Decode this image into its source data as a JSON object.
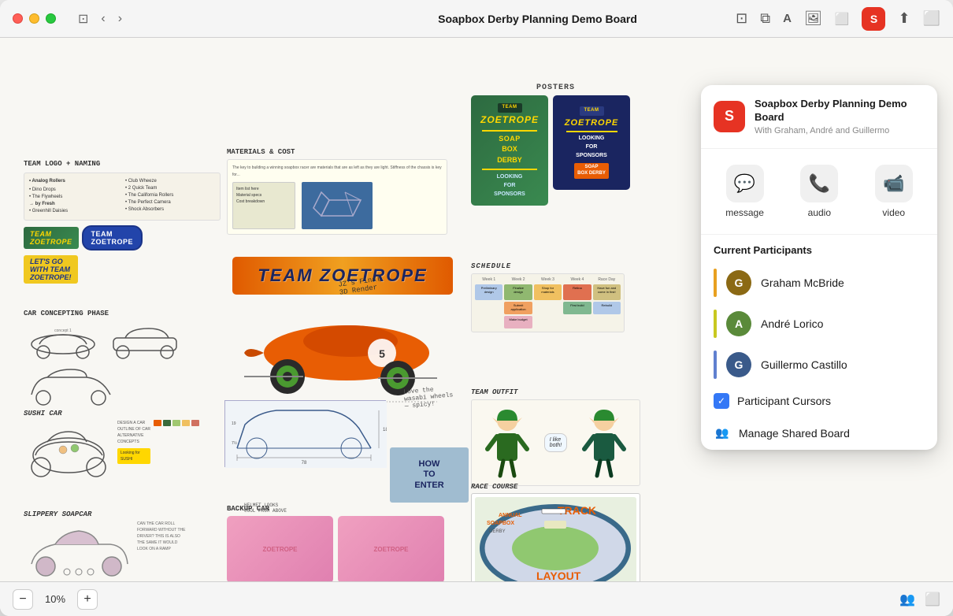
{
  "window": {
    "title": "Soapbox Derby Planning Demo Board"
  },
  "titlebar": {
    "title": "Soapbox Derby Planning Demo Board",
    "back_btn": "‹",
    "forward_btn": "›"
  },
  "toolbar": {
    "panel_icon": "⊡",
    "layers_icon": "⧉",
    "text_icon": "T",
    "image_icon": "🖼",
    "folder_icon": "⬜"
  },
  "bottom_bar": {
    "zoom_minus": "−",
    "zoom_value": "10%",
    "zoom_plus": "+",
    "share_icon": "👥",
    "grid_icon": "⊞"
  },
  "share_panel": {
    "app_icon_label": "S",
    "board_title": "Soapbox Derby Planning Demo Board",
    "board_subtitle": "With Graham, André and Guillermo",
    "actions": [
      {
        "key": "message",
        "label": "message",
        "icon": "💬"
      },
      {
        "key": "audio",
        "label": "audio",
        "icon": "📞"
      },
      {
        "key": "video",
        "label": "video",
        "icon": "📹"
      }
    ],
    "section_title": "Current Participants",
    "participants": [
      {
        "name": "Graham McBride",
        "color": "#e8a020",
        "initials": "G"
      },
      {
        "name": "André Lorico",
        "color": "#c8c820",
        "initials": "A"
      },
      {
        "name": "Guillermo Castillo",
        "color": "#6080d0",
        "initials": "G"
      }
    ],
    "participant_cursors_label": "Participant Cursors",
    "manage_label": "Manage Shared Board"
  },
  "board": {
    "posters_label": "POSTERS",
    "materials_label": "MATERIALS & COST",
    "team_logo_label": "TEAM LOGO + NAMING",
    "car_concepting_label": "CAR CONCEPTING PHASE",
    "sushi_car_label": "SUSHI CAR",
    "slippery_label": "SLIPPERY SOAPCAR",
    "backup_car_label": "BACKUP CAR",
    "schedule_label": "SCHEDULE",
    "team_outfit_label": "TEAM OUTFIT",
    "race_course_label": "RACE COURSE",
    "team_zoetrope_banner": "TEAM ZOETROPE",
    "soap_box_derby": "SOAP BOX DERBY",
    "looking_for_sponsors": "LOOKING FOR SPONSORS",
    "how_to_enter": "HOW TO ENTER"
  }
}
